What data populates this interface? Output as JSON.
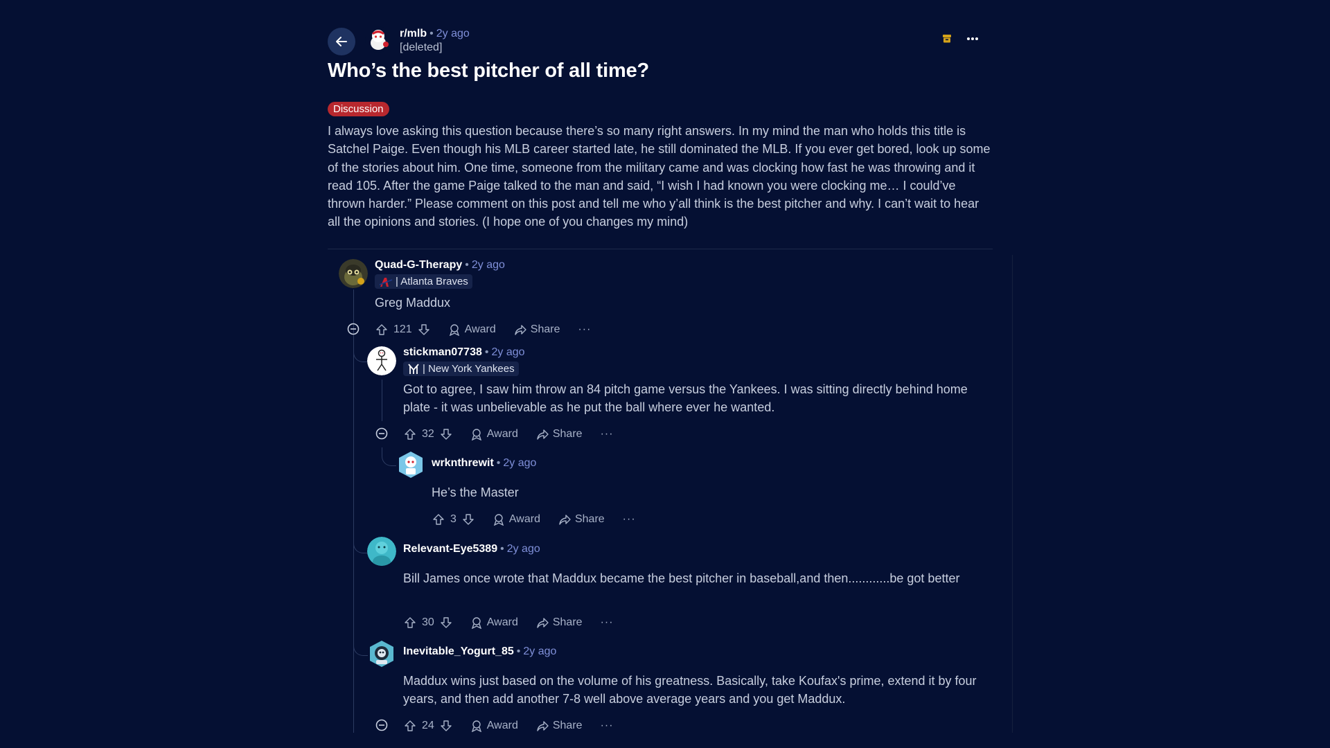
{
  "post": {
    "subreddit": "r/mlb",
    "time": "2y ago",
    "author": "[deleted]",
    "title": "Who’s the best pitcher of all time?",
    "flair": "Discussion",
    "body": "I always love asking this question because there’s so many right answers. In my mind the man who holds this title is Satchel Paige. Even though his MLB career started late, he still dominated the MLB. If you ever get bored, look up some of the stories about him. One time, someone from the military came and was clocking how fast he was throwing and it read 105. After the game Paige talked to the man and said, “I wish I had known you were clocking me… I could’ve thrown harder.” Please comment on this post and tell me who y’all think is the best pitcher and why. I can’t wait to hear all the opinions and stories. (I hope one of you changes my mind)"
  },
  "labels": {
    "award": "Award",
    "share": "Share",
    "more": "···"
  },
  "icons": [
    "back-arrow-icon",
    "archive-icon",
    "more-icon",
    "upvote-icon",
    "downvote-icon",
    "award-icon",
    "share-icon",
    "collapse-icon"
  ],
  "colors": {
    "background": "#051033",
    "flair": "#b8282e",
    "timestamp": "#7f8fd8"
  },
  "comments": [
    {
      "user": "Quad-G-Therapy",
      "time": "2y ago",
      "flair": "| Atlanta Braves",
      "text": "Greg Maddux",
      "votes": "121"
    },
    {
      "user": "stickman07738",
      "time": "2y ago",
      "flair": "| New York Yankees",
      "text": "Got to agree, I saw him throw an 84 pitch game versus the Yankees. I was sitting directly behind home plate - it was unbelievable as he put the ball where ever he wanted.",
      "votes": "32"
    },
    {
      "user": "wrknthrewit",
      "time": "2y ago",
      "text": "He’s the Master",
      "votes": "3"
    },
    {
      "user": "Relevant-Eye5389",
      "time": "2y ago",
      "text": "Bill James once wrote that Maddux became the best pitcher in baseball,and then............be got better",
      "votes": "30"
    },
    {
      "user": "Inevitable_Yogurt_85",
      "time": "2y ago",
      "text": "Maddux wins just based on the volume of his greatness. Basically, take Koufax's prime, extend it by four years, and then add another 7-8 well above average years and you get Maddux.",
      "votes": "24"
    }
  ]
}
